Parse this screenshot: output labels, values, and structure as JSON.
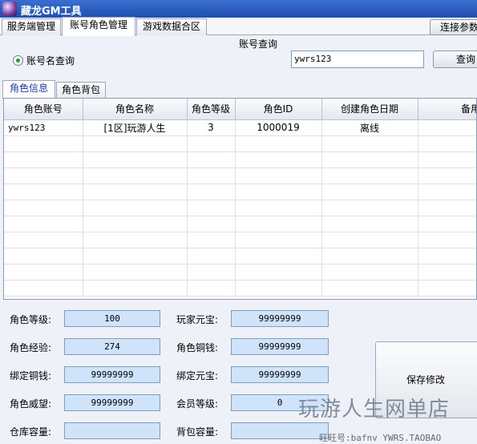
{
  "window": {
    "title": "藏龙GM工具"
  },
  "top_tabs": [
    {
      "label": "服务端管理"
    },
    {
      "label": "账号角色管理"
    },
    {
      "label": "游戏数据合区"
    }
  ],
  "top_right_button": "连接参数",
  "query": {
    "section_label": "账号查询",
    "radio_label": "账号名查询",
    "input_value": "ywrs123",
    "button_label": "查询"
  },
  "sub_tabs": [
    {
      "label": "角色信息"
    },
    {
      "label": "角色背包"
    }
  ],
  "grid": {
    "columns": [
      "角色账号",
      "角色名称",
      "角色等级",
      "角色ID",
      "创建角色日期",
      "备用列"
    ],
    "rows": [
      [
        "ywrs123",
        "[1区]玩游人生",
        "3",
        "1000019",
        "离线",
        ""
      ]
    ]
  },
  "fields": {
    "level_label": "角色等级:",
    "level_value": "100",
    "yuanbao_label": "玩家元宝:",
    "yuanbao_value": "99999999",
    "exp_label": "角色经验:",
    "exp_value": "274",
    "copper_label": "角色铜钱:",
    "copper_value": "99999999",
    "bound_copper_label": "绑定铜钱:",
    "bound_copper_value": "99999999",
    "bound_yuanbao_label": "绑定元宝:",
    "bound_yuanbao_value": "99999999",
    "prestige_label": "角色威望:",
    "prestige_value": "99999999",
    "vip_label": "会员等级:",
    "vip_value": "0",
    "warehouse_label": "仓库容量:",
    "warehouse_value": "",
    "bag_label": "背包容量:",
    "bag_value": ""
  },
  "save_button": "保存修改",
  "watermark": {
    "line1": "玩游人生网单店",
    "line2": "旺旺号:bafnv   YWRS.TAOBAO"
  }
}
